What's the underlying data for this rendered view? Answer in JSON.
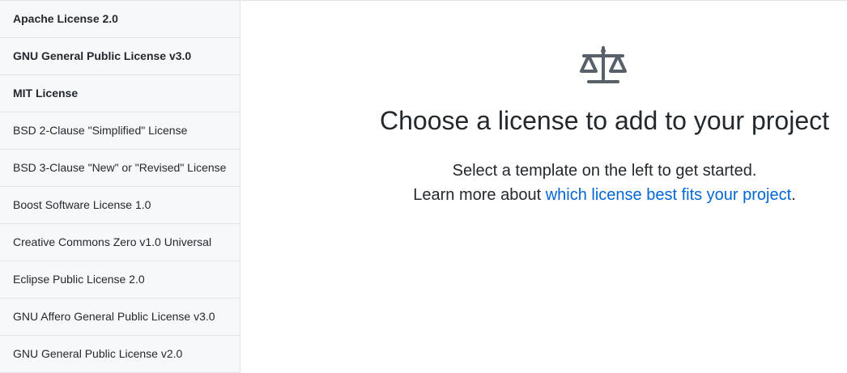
{
  "sidebar": {
    "items": [
      {
        "label": "Apache License 2.0"
      },
      {
        "label": "GNU General Public License v3.0"
      },
      {
        "label": "MIT License"
      },
      {
        "label": "BSD 2-Clause \"Simplified\" License"
      },
      {
        "label": "BSD 3-Clause \"New\" or \"Revised\" License"
      },
      {
        "label": "Boost Software License 1.0"
      },
      {
        "label": "Creative Commons Zero v1.0 Universal"
      },
      {
        "label": "Eclipse Public License 2.0"
      },
      {
        "label": "GNU Affero General Public License v3.0"
      },
      {
        "label": "GNU General Public License v2.0"
      }
    ]
  },
  "main": {
    "icon": "law-scale-icon",
    "title": "Choose a license to add to your project",
    "line1": "Select a template on the left to get started.",
    "line2_prefix": "Learn more about ",
    "line2_link": "which license best fits your project",
    "line2_suffix": "."
  },
  "colors": {
    "link": "#0366d6",
    "text": "#24292e",
    "sidebar_bg": "#f6f8fa",
    "border": "#e1e4e8",
    "icon": "#586069"
  }
}
